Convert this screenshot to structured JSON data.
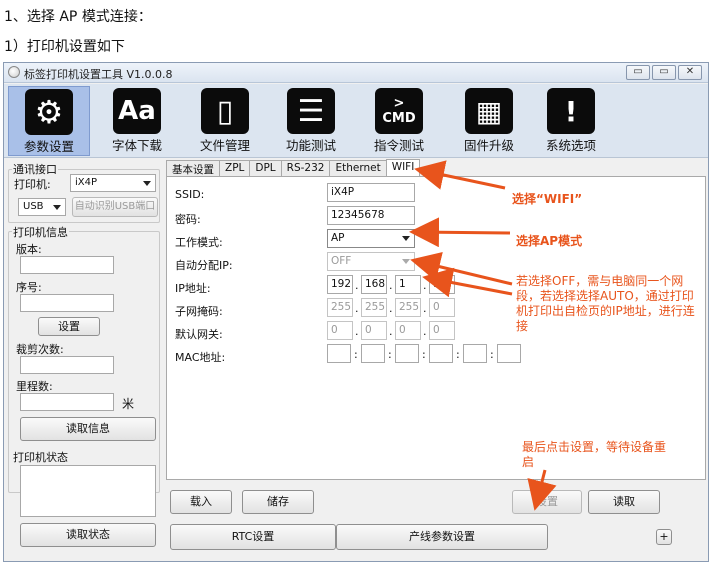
{
  "doc": {
    "line1": "1、选择 AP 模式连接：",
    "line2": "1）打印机设置如下"
  },
  "window": {
    "title": "标签打印机设置工具 V1.0.0.8",
    "controls": [
      "▭",
      "▭",
      "✕"
    ]
  },
  "toolbar": [
    {
      "label": "参数设置",
      "glyph": "⚙",
      "icon": "gear-icon",
      "active": true
    },
    {
      "label": "字体下载",
      "glyph": "Aa",
      "icon": "font-icon"
    },
    {
      "label": "文件管理",
      "glyph": "▯",
      "icon": "file-icon"
    },
    {
      "label": "功能测试",
      "glyph": "☰",
      "icon": "list-icon"
    },
    {
      "label": "指令测试",
      "glyph": "> CMD",
      "icon": "terminal-icon"
    },
    {
      "label": "固件升级",
      "glyph": "▦",
      "icon": "chip-icon"
    },
    {
      "label": "系统选项",
      "glyph": "!",
      "icon": "alert-icon"
    }
  ],
  "left": {
    "comm_title": "通讯接口",
    "printer_label": "打印机:",
    "printer_value": "iX4P",
    "port_value": "USB",
    "auto_usb": "自动识别USB端口",
    "info_title": "打印机信息",
    "version_label": "版本:",
    "serial_label": "序号:",
    "set_btn": "设置",
    "cut_label": "裁剪次数:",
    "mileage_label": "里程数:",
    "mileage_unit": "米",
    "read_info": "读取信息",
    "status_title": "打印机状态",
    "read_status": "读取状态"
  },
  "tabs": [
    "基本设置",
    "ZPL",
    "DPL",
    "RS-232",
    "Ethernet",
    "WIFI"
  ],
  "wifi": {
    "ssid_label": "SSID:",
    "ssid_value": "iX4P",
    "pwd_label": "密码:",
    "pwd_value": "12345678",
    "mode_label": "工作模式:",
    "mode_value": "AP",
    "dhcp_label": "自动分配IP:",
    "dhcp_value": "OFF",
    "ip_label": "IP地址:",
    "ip": [
      "192",
      "168",
      "1",
      "1"
    ],
    "mask_label": "子网掩码:",
    "mask": [
      "255",
      "255",
      "255",
      "0"
    ],
    "gw_label": "默认网关:",
    "gw": [
      "0",
      "0",
      "0",
      "0"
    ],
    "mac_label": "MAC地址:"
  },
  "bottom": {
    "load": "载入",
    "save": "储存",
    "set": "设置",
    "read": "读取",
    "rtc": "RTC设置",
    "line_param": "产线参数设置",
    "plus": "+"
  },
  "annotations": {
    "wifi": "选择“WIFI”",
    "ap": "选择AP模式",
    "off_note": "若选择OFF，需与电脑同一个网段，若选择选择AUTO，通过打印机打印出自检页的IP地址，进行连接",
    "set_note": "最后点击设置，等待设备重启"
  },
  "colors": {
    "annotation": "#e8541c",
    "toolbar": "#dce5f0",
    "active_tool": "#a9c0e8"
  }
}
